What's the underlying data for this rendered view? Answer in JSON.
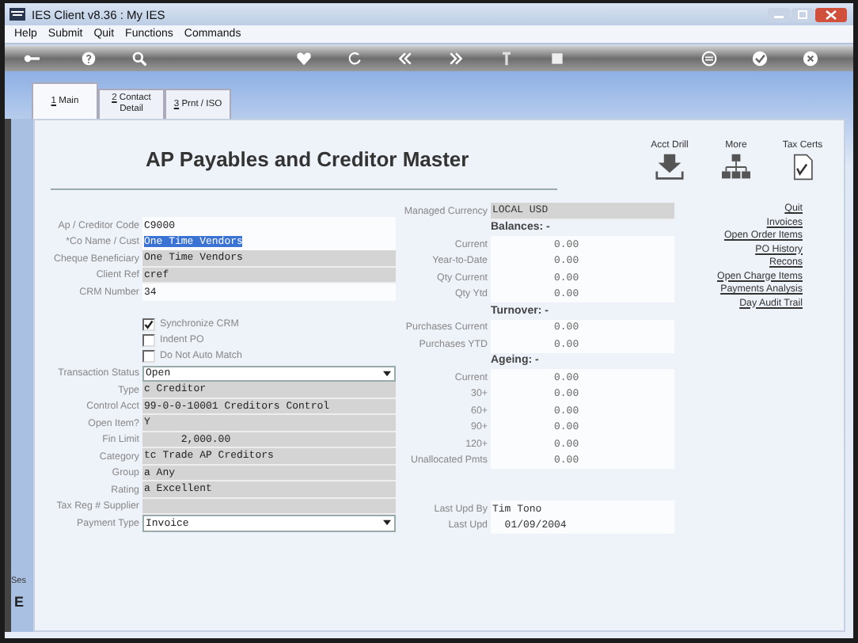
{
  "window": {
    "title": "IES Client v8.36 : My IES"
  },
  "menu": [
    "Help",
    "Submit",
    "Quit",
    "Functions",
    "Commands"
  ],
  "tabs": [
    {
      "key": "1",
      "label": " Main",
      "selected": true
    },
    {
      "key": "2",
      "label": " Contact Detail",
      "selected": false
    },
    {
      "key": "3",
      "label": " Prnt / ISO",
      "selected": false
    }
  ],
  "heading": "AP Payables and Creditor Master",
  "actions": [
    {
      "label": "Acct Drill",
      "kind": "drill"
    },
    {
      "label": "More",
      "kind": "tree"
    },
    {
      "label": "Tax Certs",
      "kind": "cert"
    }
  ],
  "fields_top": [
    {
      "label": "Ap / Creditor Code",
      "value": "C9000",
      "kind": "plain"
    },
    {
      "label": "*Co Name / Cust",
      "value": "One Time Vendors",
      "kind": "highlight"
    },
    {
      "label": "Cheque Beneficiary",
      "value": "One Time Vendors",
      "kind": "readonly"
    },
    {
      "label": "Client Ref",
      "value": "cref",
      "kind": "readonly"
    },
    {
      "label": "CRM Number",
      "value": "34",
      "kind": "plain"
    }
  ],
  "checkboxes": [
    {
      "label": "Synchronize CRM",
      "checked": true
    },
    {
      "label": "Indent PO",
      "checked": false
    },
    {
      "label": "Do Not Auto Match",
      "checked": false
    }
  ],
  "fields_bottom": [
    {
      "label": "Transaction Status",
      "value": "Open",
      "kind": "dropdown"
    },
    {
      "label": "Type",
      "value": "c Creditor",
      "kind": "readonly"
    },
    {
      "label": "Control Acct",
      "value": "99-0-0-10001 Creditors Control",
      "kind": "readonly"
    },
    {
      "label": "Open Item?",
      "value": "Y",
      "kind": "readonly"
    },
    {
      "label": "Fin Limit",
      "value": "      2,000.00",
      "kind": "readonly"
    },
    {
      "label": "Category",
      "value": "tc Trade AP Creditors",
      "kind": "readonly"
    },
    {
      "label": "Group",
      "value": "a Any",
      "kind": "readonly"
    },
    {
      "label": "Rating",
      "value": "a Excellent",
      "kind": "readonly"
    },
    {
      "label": "Tax Reg # Supplier",
      "kind": "readonly"
    },
    {
      "label": "Payment Type",
      "value": "Invoice",
      "kind": "dropdown"
    }
  ],
  "currency": {
    "label": "Managed Currency",
    "value": "LOCAL USD"
  },
  "sections": [
    {
      "title": "Balances: -",
      "rows": [
        {
          "label": "Current",
          "value": "0.00"
        },
        {
          "label": "Year-to-Date",
          "value": "0.00"
        },
        {
          "label": "Qty Current",
          "value": "0.00"
        },
        {
          "label": "Qty Ytd",
          "value": "0.00"
        }
      ]
    },
    {
      "title": "Turnover: -",
      "rows": [
        {
          "label": "Purchases Current",
          "value": "0.00"
        },
        {
          "label": "Purchases YTD",
          "value": "0.00"
        }
      ]
    },
    {
      "title": "Ageing: -",
      "rows": [
        {
          "label": "Current",
          "value": "0.00"
        },
        {
          "label": "30+",
          "value": "0.00"
        },
        {
          "label": "60+",
          "value": "0.00"
        },
        {
          "label": "90+",
          "value": "0.00"
        },
        {
          "label": "120+",
          "value": "0.00"
        },
        {
          "label": "Unallocated Pmts",
          "value": "0.00"
        }
      ]
    }
  ],
  "audit": [
    {
      "label": "Last Upd By",
      "value": "Tim Tono"
    },
    {
      "label": "Last Upd",
      "value": "  01/09/2004"
    }
  ],
  "links": [
    "Quit",
    "Invoices",
    "Open Order Items",
    "PO History",
    "Recons",
    "Open Charge Items",
    "Payments Analysis",
    "Day Audit Trail"
  ],
  "side": [
    "Ses",
    "E"
  ]
}
